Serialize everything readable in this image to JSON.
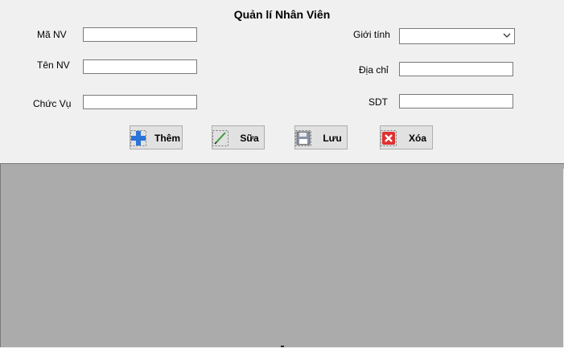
{
  "form": {
    "title": "Quản lí Nhân Viên",
    "fields": {
      "ma_nv": {
        "label": "Mã NV",
        "value": ""
      },
      "ten_nv": {
        "label": "Tên NV",
        "value": ""
      },
      "chuc_vu": {
        "label": "Chức Vụ",
        "value": ""
      },
      "gioi_tinh": {
        "label": "Giới tính",
        "value": ""
      },
      "dia_chi": {
        "label": "Địa chỉ",
        "value": ""
      },
      "sdt": {
        "label": "SDT",
        "value": ""
      }
    }
  },
  "toolbar": {
    "add_label": "Thêm",
    "edit_label": "Sữa",
    "save_label": "Lưu",
    "delete_label": "Xóa"
  },
  "icons": {
    "add": "plus-icon",
    "edit": "pencil-icon",
    "save": "floppy-disk-icon",
    "delete": "delete-x-icon",
    "dropdown": "chevron-down-icon"
  },
  "colors": {
    "window_bg": "#f0f0f0",
    "grid_bg": "#ababab",
    "add_icon": "#2b74d9",
    "delete_icon": "#e03030"
  }
}
